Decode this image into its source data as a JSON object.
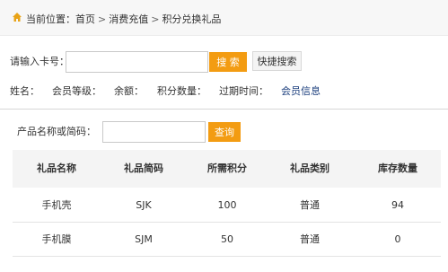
{
  "breadcrumb": {
    "location_label": "当前位置：",
    "items": [
      "首页",
      "消费充值",
      "积分兑换礼品"
    ],
    "separator": ">"
  },
  "card_search": {
    "label": "请输入卡号：",
    "value": "",
    "search_button": "搜 索",
    "quick_search_button": "快捷搜索"
  },
  "member_info": {
    "name_label": "姓名：",
    "level_label": "会员等级：",
    "balance_label": "余额：",
    "points_label": "积分数量：",
    "expiry_label": "过期时间：",
    "member_info_link": "会员信息"
  },
  "product_search": {
    "label": "产品名称或简码：",
    "value": "",
    "query_button": "查询"
  },
  "gift_table": {
    "columns": [
      "礼品名称",
      "礼品简码",
      "所需积分",
      "礼品类别",
      "库存数量"
    ],
    "rows": [
      [
        "手机壳",
        "SJK",
        "100",
        "普通",
        "94"
      ],
      [
        "手机膜",
        "SJM",
        "50",
        "普通",
        "0"
      ]
    ]
  },
  "colors": {
    "accent": "#f39c12",
    "link": "#1a3d7c",
    "header_bg": "#f4f4f4"
  }
}
